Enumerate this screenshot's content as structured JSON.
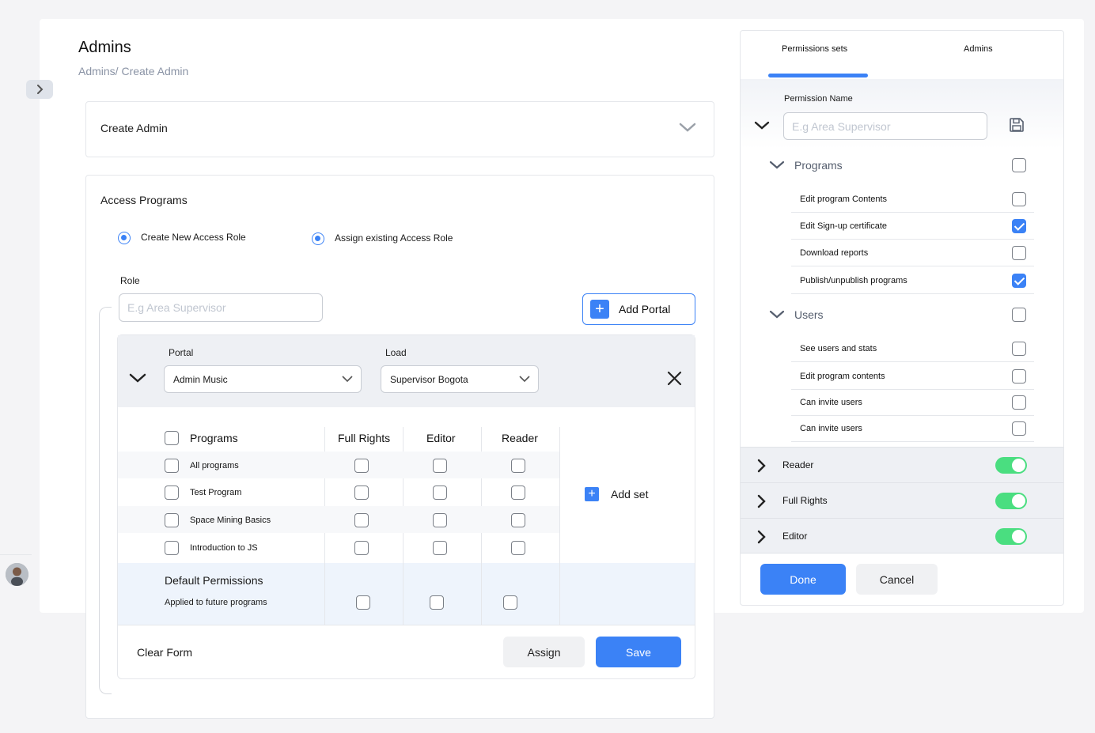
{
  "header": {
    "title": "Admins",
    "breadcrumb": "Admins/ Create Admin"
  },
  "create_admin": {
    "title": "Create Admin"
  },
  "access": {
    "title": "Access Programs",
    "radio_new": "Create New Access Role",
    "radio_existing": "Assign existing Access Role",
    "role_label": "Role",
    "role_placeholder": "E.g Area Supervisor",
    "add_portal": "Add Portal",
    "portal": {
      "portal_label": "Portal",
      "portal_value": "Admin Music",
      "load_label": "Load",
      "load_value": "Supervisor Bogota"
    },
    "table": {
      "headers": [
        "Programs",
        "Full Rights",
        "Editor",
        "Reader"
      ],
      "rows": [
        "All programs",
        "Test Program",
        "Space Mining Basics",
        "Introduction to JS"
      ],
      "add_set": "Add set",
      "default_title": "Default Permissions",
      "default_sub": "Applied to future programs"
    },
    "buttons": {
      "clear": "Clear Form",
      "assign": "Assign",
      "save": "Save"
    }
  },
  "permissions_panel": {
    "tabs": [
      "Permissions sets",
      "Admins"
    ],
    "active_tab": "Permissions sets",
    "name_label": "Permission Name",
    "name_placeholder": "E.g Area Supervisor",
    "groups": [
      {
        "label": "Programs",
        "items": [
          {
            "label": "Edit program Contents",
            "checked": false
          },
          {
            "label": "Edit Sign-up certificate",
            "checked": true
          },
          {
            "label": "Download reports",
            "checked": false
          },
          {
            "label": "Publish/unpublish programs",
            "checked": true
          }
        ]
      },
      {
        "label": "Users",
        "items": [
          {
            "label": "See users and stats",
            "checked": false
          },
          {
            "label": "Edit program contents",
            "checked": false
          },
          {
            "label": "Can invite users",
            "checked": false
          },
          {
            "label": "Can invite users",
            "checked": false
          }
        ]
      }
    ],
    "roles": [
      {
        "label": "Reader",
        "enabled": true
      },
      {
        "label": "Full Rights",
        "enabled": true
      },
      {
        "label": "Editor",
        "enabled": true
      }
    ],
    "buttons": {
      "done": "Done",
      "cancel": "Cancel"
    }
  },
  "colors": {
    "accent": "#3b82f6",
    "toggle_on": "#4ade80"
  }
}
